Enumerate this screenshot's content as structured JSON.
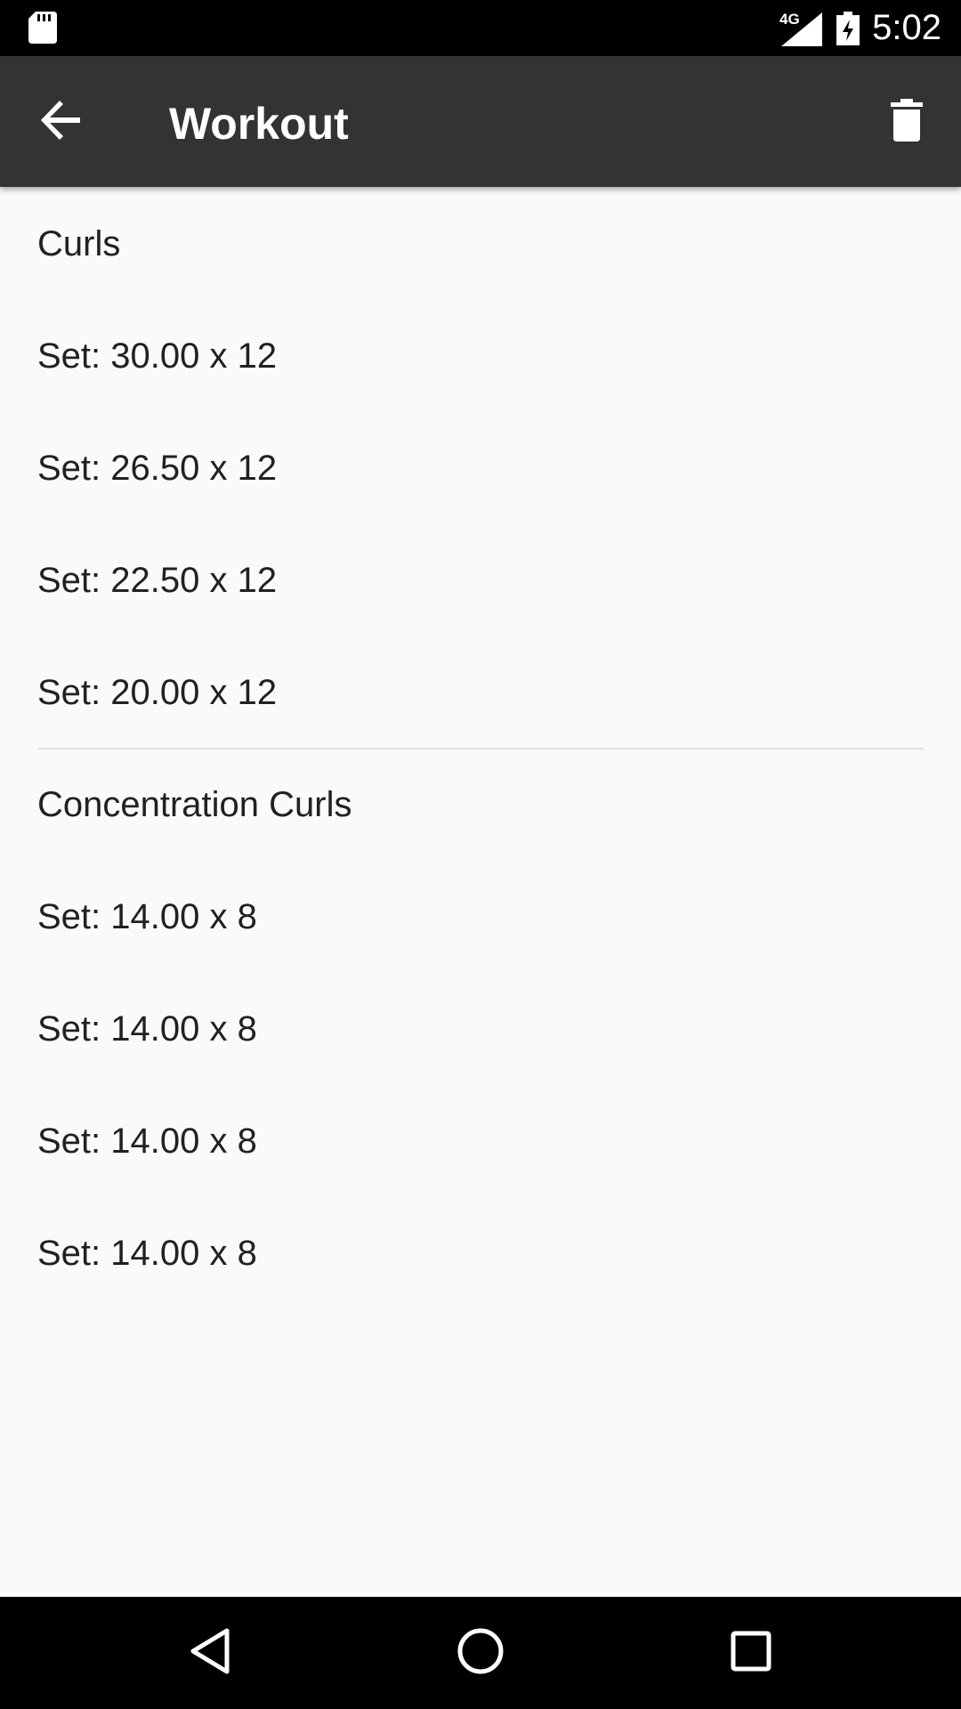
{
  "status_bar": {
    "network_label": "4G",
    "time": "5:02",
    "icons": [
      "sd-card-icon",
      "signal-icon",
      "battery-charging-icon"
    ]
  },
  "app_bar": {
    "title": "Workout",
    "back_icon": "arrow-back-icon",
    "action_icon": "delete-icon",
    "background": "#333333"
  },
  "exercises": [
    {
      "name": "Curls",
      "sets": [
        "Set: 30.00 x 12",
        "Set: 26.50 x 12",
        "Set: 22.50 x 12",
        "Set: 20.00 x 12"
      ]
    },
    {
      "name": "Concentration Curls",
      "sets": [
        "Set: 14.00 x 8",
        "Set: 14.00 x 8",
        "Set: 14.00 x 8",
        "Set: 14.00 x 8"
      ]
    }
  ],
  "nav_bar": {
    "icons": [
      "back-triangle-icon",
      "home-circle-icon",
      "recents-square-icon"
    ]
  }
}
